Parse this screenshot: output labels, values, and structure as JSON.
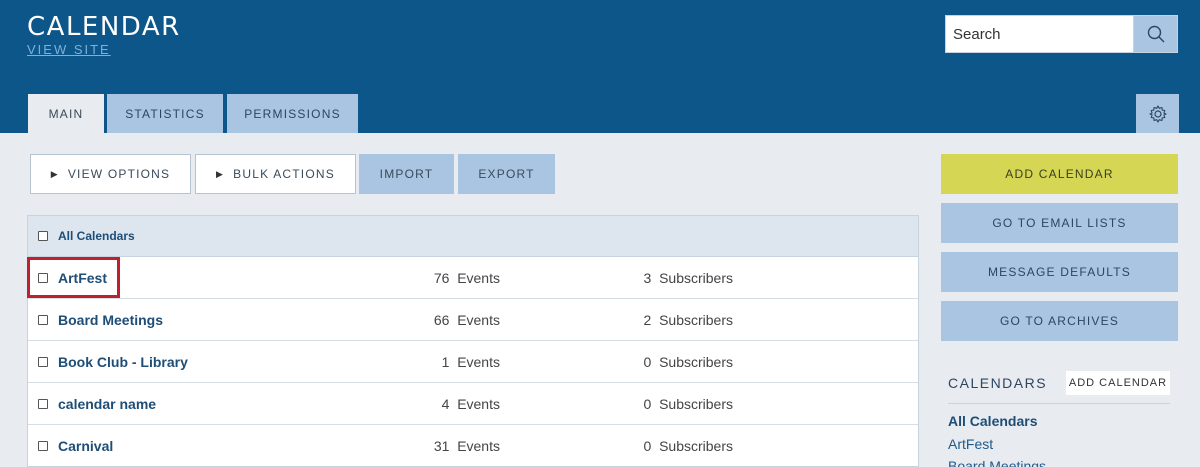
{
  "header": {
    "title": "CALENDAR",
    "view_site": "VIEW SITE",
    "search_placeholder": "Search",
    "search_icon": "search-icon",
    "settings_icon": "gear-icon"
  },
  "tabs": [
    {
      "label": "MAIN",
      "active": true
    },
    {
      "label": "STATISTICS",
      "active": false
    },
    {
      "label": "PERMISSIONS",
      "active": false
    }
  ],
  "toolbar": {
    "view_options": "VIEW OPTIONS",
    "bulk_actions": "BULK ACTIONS",
    "import": "IMPORT",
    "export": "EXPORT"
  },
  "table": {
    "header_label": "All Calendars",
    "rows": [
      {
        "name": "ArtFest",
        "events": "76",
        "events_label": "Events",
        "subscribers": "3",
        "subscribers_label": "Subscribers"
      },
      {
        "name": "Board Meetings",
        "events": "66",
        "events_label": "Events",
        "subscribers": "2",
        "subscribers_label": "Subscribers"
      },
      {
        "name": "Book Club - Library",
        "events": "1",
        "events_label": "Events",
        "subscribers": "0",
        "subscribers_label": "Subscribers"
      },
      {
        "name": "calendar name",
        "events": "4",
        "events_label": "Events",
        "subscribers": "0",
        "subscribers_label": "Subscribers"
      },
      {
        "name": "Carnival",
        "events": "31",
        "events_label": "Events",
        "subscribers": "0",
        "subscribers_label": "Subscribers"
      }
    ]
  },
  "sidebar": {
    "add_calendar": "ADD CALENDAR",
    "email_lists": "GO TO EMAIL LISTS",
    "message_defaults": "MESSAGE DEFAULTS",
    "archives": "GO TO ARCHIVES",
    "calendars_title": "CALENDARS",
    "calendars_add": "ADD CALENDAR",
    "links": [
      "All Calendars",
      "ArtFest",
      "Board Meetings"
    ]
  },
  "colors": {
    "header_bg": "#0c5689",
    "accent_blue": "#a9c5e2",
    "add_button": "#d5d654",
    "highlight": "#c0202e"
  }
}
